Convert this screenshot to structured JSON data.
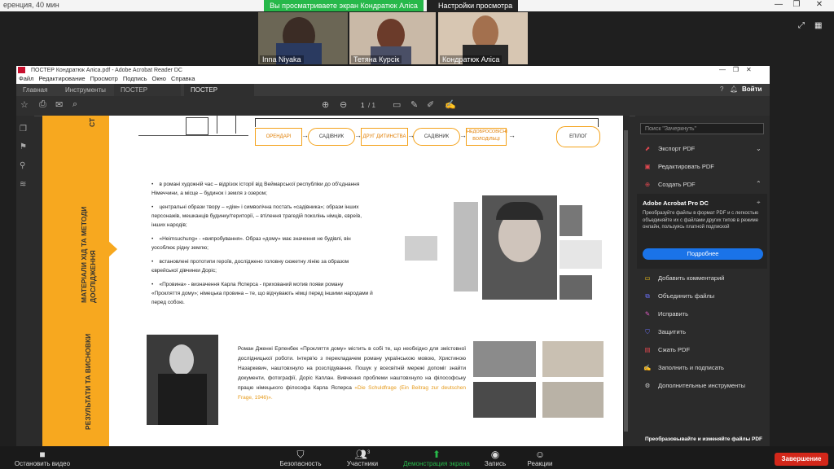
{
  "zoom": {
    "window_title": "еренция, 40 мин",
    "share_banner": "Вы просматриваете экран Кондратюк Аліса",
    "view_options": "Настройки просмотра",
    "participants": [
      {
        "name": "Inna Niyaka"
      },
      {
        "name": "Тетяна Курсік"
      },
      {
        "name": "Кондратюк Аліса"
      }
    ],
    "bottom_bar": {
      "stop_video": "Остановить видео",
      "security": "Безопасность",
      "participants": "Участники",
      "participants_count": "3",
      "share_screen": "Демонстрация экрана",
      "record": "Запись",
      "reactions": "Реакции",
      "end": "Завершение"
    }
  },
  "acrobat": {
    "title": "ПОСТЕР Кондратюк Аліса.pdf - Adobe Acrobat Reader DC",
    "menu": [
      "Файл",
      "Редактирование",
      "Просмотр",
      "Подпись",
      "Окно",
      "Справка"
    ],
    "tabs": [
      "Главная",
      "Инструменты",
      "ПОСТЕР КОНДРАТ...",
      "ПОСТЕР Кондратю..."
    ],
    "login": "Войти",
    "page_current": "1",
    "page_total": "/ 1",
    "right_panel": {
      "search_placeholder": "Поиск \"Зачеркнуть\"",
      "export_pdf": "Экспорт PDF",
      "edit_pdf": "Редактировать PDF",
      "create_pdf": "Создать PDF",
      "promo_title": "Adobe Acrobat Pro DC",
      "promo_text": "Преобразуйте файлы в формат PDF и с легкостью объединяйте их с файлами других типов в режиме онлайн, пользуясь платной подпиской",
      "more_button": "Подробнее",
      "tools": [
        "Добавить комментарий",
        "Объединить файлы",
        "Исправить",
        "Защитить",
        "Сжать PDF",
        "Заполнить и подписать",
        "Дополнительные инструменты"
      ],
      "footer": "Преобразовывайте и изменяйте файлы PDF"
    }
  },
  "poster": {
    "side_labels": [
      "СТ",
      "МАТЕРІАЛИ ХІД ТА МЕТОДИ ДОСЛІДЖЕННЯ",
      "РЕЗУЛЬТАТИ ТА ВИСНОВКИ"
    ],
    "flow": [
      "ОРЕНДАРІ",
      "САДІВНИК",
      "ДРУГ ДИТИНСТВА",
      "САДІВНИК",
      "НЕДОБРОСОВІСНІ ВОЛОДІЛЬЦІ",
      "ЕПІЛОГ"
    ],
    "bullets": [
      "в романі художній час – відрізок історії від Веймарської республіки до об'єднання Німеччини, а місце – будинок і земля з озером;",
      "центральні образи твору – «дім» і символічна постать «садівника»; образи інших персонажів, мешканців будинку/території, – втілення трагедій поколінь німців, євреїв, інших народів;",
      "«Heimsuchung» - «випробування». Образ «дому» має значення не будівлі, він уособлює рідну землю;",
      "встановлені прототипи героїв, досліджено головну сюжетну лінію за образом єврейської дівчинки Доріс;",
      "«Провина» - визначення Карла Ясперса - прихований мотив появи роману «Прокляття дому»; німецька провина – те, що відчувають німці перед іншими народами й перед собою."
    ],
    "results_text": "Роман Дженні Ерпенбек «Прокляття дому» містить в собі те, що необхідно для змістовної дослідницької роботи. Інтерв'ю з перекладачем роману українською мовою, Христиною Назаркевич, наштовхнуло на розслідування. Пошук у всесвітній мережі допоміг знайти документи, фотографії, Доріс Каплан. Вивчення проблеми наштовхнуло на філософську працю німецького філософа Карла Ясперса",
    "results_link": "«Die Schuldfrage (Ein Beitrag zur deutschen Frage, 1946)»."
  }
}
